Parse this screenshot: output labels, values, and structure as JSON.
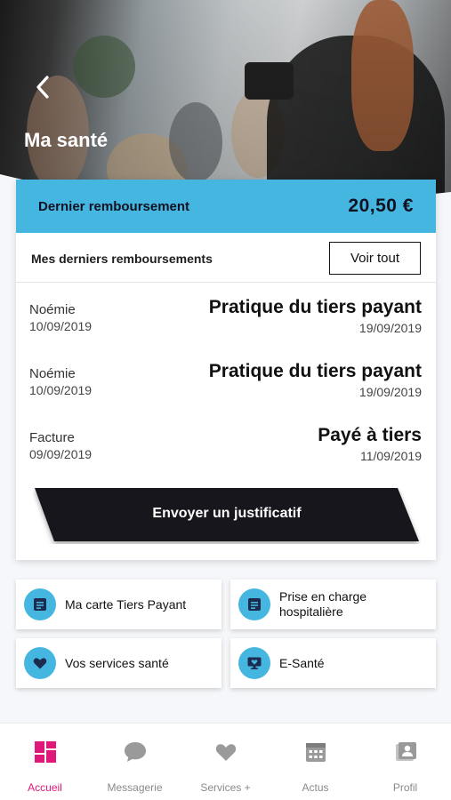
{
  "header": {
    "title": "Ma santé"
  },
  "summary": {
    "label": "Dernier remboursement",
    "amount": "20,50  €"
  },
  "recent": {
    "title": "Mes derniers remboursements",
    "see_all": "Voir tout",
    "items": [
      {
        "source": "Noémie",
        "source_date": "10/09/2019",
        "label": "Pratique du tiers payant",
        "date": "19/09/2019"
      },
      {
        "source": "Noémie",
        "source_date": "10/09/2019",
        "label": "Pratique du tiers payant",
        "date": "19/09/2019"
      },
      {
        "source": "Facture",
        "source_date": "09/09/2019",
        "label": "Payé à tiers",
        "date": "11/09/2019"
      }
    ],
    "send_button": "Envoyer un justificatif"
  },
  "tiles": [
    {
      "label": "Ma carte Tiers Payant",
      "icon": "card-icon"
    },
    {
      "label": "Prise en charge hospitalière",
      "icon": "document-icon"
    },
    {
      "label": "Vos services santé",
      "icon": "heart-icon"
    },
    {
      "label": "E-Santé",
      "icon": "monitor-heart-icon"
    }
  ],
  "nav": {
    "items": [
      {
        "label": "Accueil",
        "icon": "home-grid-icon",
        "active": true
      },
      {
        "label": "Messagerie",
        "icon": "chat-bubble-icon",
        "active": false
      },
      {
        "label": "Services +",
        "icon": "heart-icon",
        "active": false
      },
      {
        "label": "Actus",
        "icon": "calendar-icon",
        "active": false
      },
      {
        "label": "Profil",
        "icon": "profile-card-icon",
        "active": false
      }
    ]
  },
  "colors": {
    "accent_blue": "#45b6df",
    "active_pink": "#e0187a",
    "button_dark": "#15121a"
  }
}
